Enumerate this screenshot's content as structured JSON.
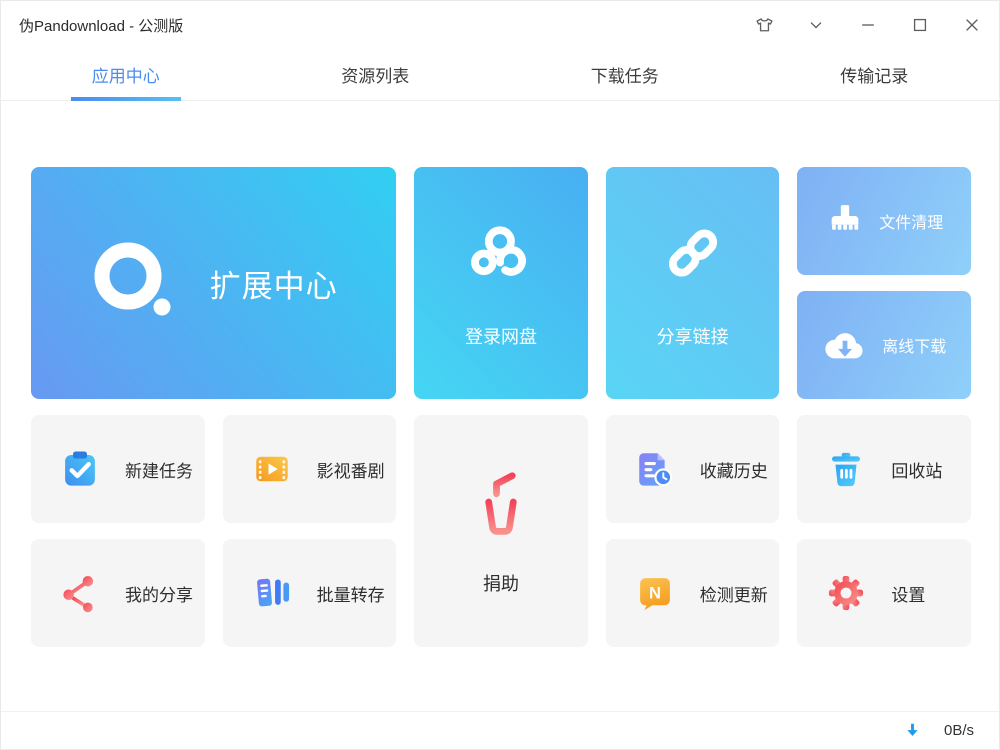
{
  "window": {
    "title": "伪Pandownload - 公测版",
    "controls": [
      {
        "name": "theme",
        "icon": "tshirt-icon"
      },
      {
        "name": "collapse",
        "icon": "chevron-down-icon"
      },
      {
        "name": "minimize",
        "icon": "minimize-icon"
      },
      {
        "name": "maximize",
        "icon": "maximize-icon"
      },
      {
        "name": "close",
        "icon": "close-icon"
      }
    ]
  },
  "tabs": [
    {
      "label": "应用中心",
      "active": true
    },
    {
      "label": "资源列表",
      "active": false
    },
    {
      "label": "下载任务",
      "active": false
    },
    {
      "label": "传输记录",
      "active": false
    }
  ],
  "tiles": {
    "extension_center": {
      "label": "扩展中心",
      "icon": "ring-icon"
    },
    "login_netdisk": {
      "label": "登录网盘",
      "icon": "baidu-cloud-icon"
    },
    "share_link": {
      "label": "分享链接",
      "icon": "chain-link-icon"
    },
    "file_cleanup": {
      "label": "文件清理",
      "icon": "brush-icon"
    },
    "offline_download": {
      "label": "离线下载",
      "icon": "cloud-download-icon"
    },
    "new_task": {
      "label": "新建任务",
      "icon": "clipboard-check-icon"
    },
    "movies": {
      "label": "影视番剧",
      "icon": "film-play-icon"
    },
    "donate": {
      "label": "捐助",
      "icon": "drink-cup-icon"
    },
    "favorites_history": {
      "label": "收藏历史",
      "icon": "document-clock-icon"
    },
    "recycle_bin": {
      "label": "回收站",
      "icon": "trash-icon"
    },
    "my_shares": {
      "label": "我的分享",
      "icon": "share-nodes-icon"
    },
    "batch_transfer": {
      "label": "批量转存",
      "icon": "batch-transfer-icon"
    },
    "check_update": {
      "label": "检测更新",
      "icon": "n-badge-icon",
      "icon_glyph": "N"
    },
    "settings": {
      "label": "设置",
      "icon": "gear-icon"
    }
  },
  "statusbar": {
    "download_speed": "0B/s",
    "icon": "download-arrow-icon"
  },
  "colors": {
    "accent_blue": "#4a8cf0",
    "tab_underline": "linear #4a8bf0 -> #55c0f5",
    "tile_big_gradient": "#6899F2 -> #31CFF2",
    "tile_login_gradient": "#49AFF2 -> #45D6F3",
    "tile_share_gradient": "#67BEF4 -> #59D5F5",
    "tile_light_gradient": "#7FB0F4 -> #8FD0FA",
    "tile_gray_bg": "#f5f5f6",
    "status_arrow_blue": "#1E9BF0",
    "donate_red": "#F25063",
    "settings_red": "#F34552",
    "update_orange": "#F59D1F"
  }
}
